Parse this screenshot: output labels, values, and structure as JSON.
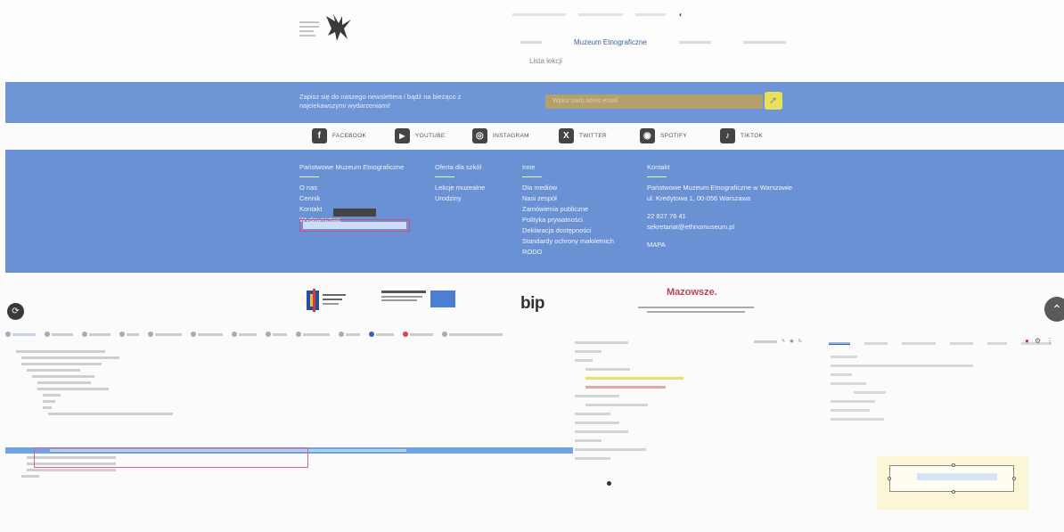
{
  "site": {
    "menu": {
      "active": "Muzeum Etnograficzne",
      "sub": "Lista lekcji"
    },
    "newsletter": {
      "text": "Zapisz się do naszego newslettera i bądź na bieżąco z najciekawszymi wydarzeniami!",
      "placeholder": "Wpisz swój adres email",
      "button_icon": "arrow-right-icon"
    },
    "social": [
      {
        "label": "FACEBOOK",
        "icon": "f"
      },
      {
        "label": "YOUTUBE",
        "icon": "▶"
      },
      {
        "label": "INSTAGRAM",
        "icon": "◎"
      },
      {
        "label": "TWITTER",
        "icon": "X"
      },
      {
        "label": "SPOTIFY",
        "icon": "◉"
      },
      {
        "label": "TIKTOK",
        "icon": "♪"
      }
    ],
    "footer": {
      "col1": {
        "title": "Państwowe Muzeum Etnograficzne",
        "items": [
          "O nas",
          "Cennik",
          "Kontakt",
          "Wydawnictwa"
        ]
      },
      "col2": {
        "title": "Oferta dla szkół",
        "items": [
          "Lekcje muzealne",
          "Urodziny"
        ]
      },
      "col3": {
        "title": "Inne",
        "items": [
          "Dla mediów",
          "Nasi zespół",
          "Zamówienia publiczne",
          "Polityka prywatności",
          "Deklaracja dostępności",
          "Standardy ochrony małoletnich",
          "RODO"
        ]
      },
      "col4": {
        "title": "Kontakt",
        "items": [
          "Państwowe Muzeum Etnograficzne w Warszawie",
          "ul. Kredytowa 1, 00-056 Warszawa",
          "22 827 76 41",
          "sekretariat@ethnomuseum.pl",
          "MAPA"
        ]
      }
    },
    "partners": {
      "bip": "bip",
      "mazowsze": "Mazowsze."
    }
  }
}
